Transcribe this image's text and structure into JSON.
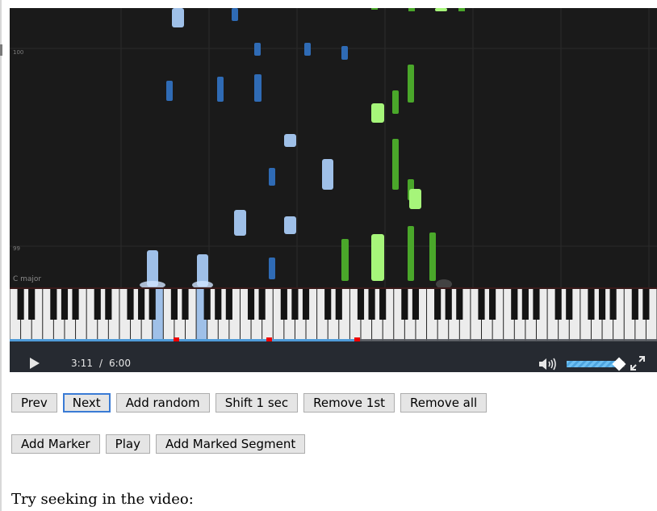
{
  "player": {
    "roll_labels": {
      "upper": "100",
      "lower": "99"
    },
    "key_signature": "C major",
    "colors": {
      "left_hand_dark": "#2f6bb5",
      "left_hand_light": "#9fc0e8",
      "right_hand_dark": "#4aa72a",
      "right_hand_light": "#a6f57a",
      "progress": "#4f9bd8",
      "marker": "#e00000"
    },
    "controls": {
      "play_icon": "play-icon",
      "current_time": "3:11",
      "separator": "/",
      "duration": "6:00",
      "progress_fraction": 0.54,
      "markers": [
        "marker-1",
        "marker-2",
        "marker-3"
      ],
      "volume_icon": "speaker-icon",
      "volume_level": 0.9,
      "fullscreen_icon": "fullscreen-icon"
    }
  },
  "buttons_row1": [
    "Prev",
    "Next",
    "Add random",
    "Shift 1 sec",
    "Remove 1st",
    "Remove all"
  ],
  "buttons_row2": [
    "Add Marker",
    "Play",
    "Add Marked Segment"
  ],
  "focused_button": "Next",
  "seek_text": "Try seeking in the video:"
}
